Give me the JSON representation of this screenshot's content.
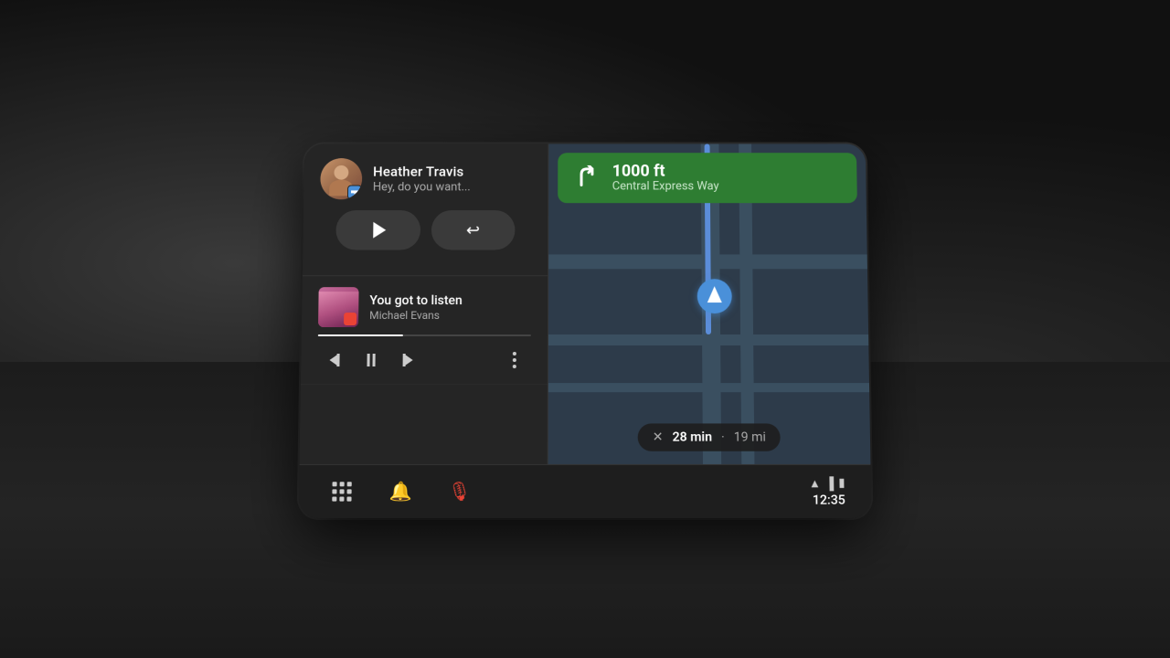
{
  "background": {
    "color": "#111111"
  },
  "notification": {
    "sender": "Heather Travis",
    "message": "Hey, do you want...",
    "play_label": "Play",
    "reply_label": "Reply"
  },
  "music": {
    "title": "You got to listen",
    "artist": "Michael Evans",
    "progress_percent": 40
  },
  "navigation": {
    "distance": "1000 ft",
    "street": "Central Express Way",
    "eta_time": "28 min",
    "eta_dot": "·",
    "eta_distance": "19 mi"
  },
  "status_bar": {
    "time": "12:35"
  },
  "controls": {
    "skip_back_label": "Skip back",
    "pause_label": "Pause",
    "skip_fwd_label": "Skip forward",
    "more_label": "More options"
  }
}
